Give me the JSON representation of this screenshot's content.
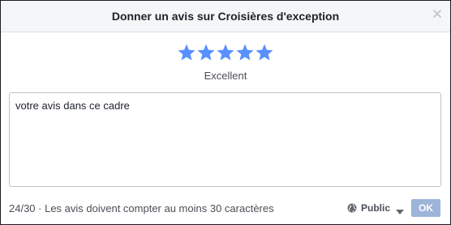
{
  "dialog": {
    "title": "Donner un avis sur Croisières d'exception",
    "close_icon": "close-icon"
  },
  "rating": {
    "stars_total": 5,
    "stars_selected": 5,
    "star_color": "#5890ff",
    "label": "Excellent"
  },
  "review": {
    "value": "votre avis dans ce cadre"
  },
  "footer": {
    "note": "24/30 · Les avis doivent compter au moins 30 caractères",
    "privacy_icon": "globe-icon",
    "privacy_label": "Public",
    "privacy_caret_icon": "caret-down-icon",
    "ok_label": "OK",
    "ok_color": "#9cb4d8"
  }
}
